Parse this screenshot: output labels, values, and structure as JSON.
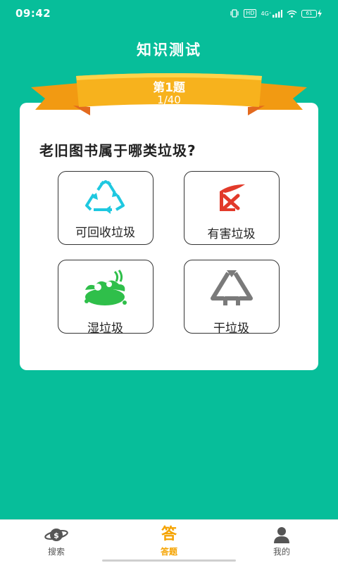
{
  "status_bar": {
    "time": "09:42",
    "hd_badge": "HD",
    "network": "4G⁺",
    "battery": "61"
  },
  "header": {
    "title": "知识测试"
  },
  "quiz": {
    "number_label": "第1题",
    "progress": "1/40",
    "question": "老旧图书属于哪类垃圾?",
    "options": [
      {
        "label": "可回收垃圾",
        "icon": "recycle-icon",
        "color": "#1ec8e0"
      },
      {
        "label": "有害垃圾",
        "icon": "hazardous-icon",
        "color": "#e23a2a"
      },
      {
        "label": "湿垃圾",
        "icon": "wet-waste-icon",
        "color": "#2fbf4a"
      },
      {
        "label": "干垃圾",
        "icon": "dry-waste-icon",
        "color": "#7a7a7a"
      }
    ]
  },
  "bottom_nav": {
    "items": [
      {
        "label": "搜索",
        "icon": "planet-search-icon"
      },
      {
        "label": "答题",
        "icon": "answer-icon",
        "icon_text": "答",
        "active": true
      },
      {
        "label": "我的",
        "icon": "user-icon"
      }
    ]
  },
  "colors": {
    "background": "#07be9a",
    "accent": "#f5a300",
    "ribbon": "#f7b21d"
  }
}
